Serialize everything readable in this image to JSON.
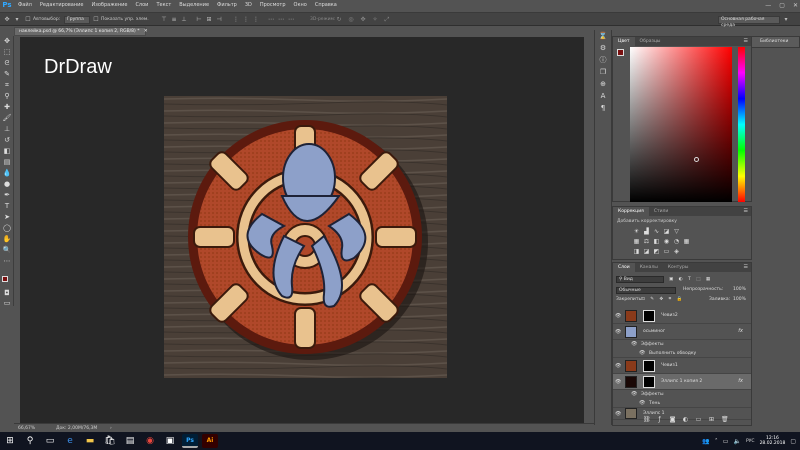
{
  "menubar": {
    "logo": "Ps",
    "items": [
      "Файл",
      "Редактирование",
      "Изображение",
      "Слои",
      "Текст",
      "Выделение",
      "Фильтр",
      "3D",
      "Просмотр",
      "Окно",
      "Справка"
    ]
  },
  "options": {
    "autoselect": "Автовыбор:",
    "group_value": "Группа",
    "show_controls": "Показать упр. элем.",
    "mode_3d": "3D-режим:",
    "workspace": "Основная рабочая среда"
  },
  "document": {
    "tab_title": "наклейка.psd @ 66,7% (Эллипс 1 копия 2, RGB/8) *",
    "watermark": "DrDraw",
    "zoom": "66,67%",
    "doc_info": "Док: 2,00М/76,3М"
  },
  "library": {
    "label": "Библиотеки"
  },
  "color_panel": {
    "tabs": [
      "Цвет",
      "Образцы"
    ],
    "fg_color": "#7a1010",
    "bg_color": "#ffffff"
  },
  "adjustments": {
    "tabs": [
      "Коррекция",
      "Стили"
    ],
    "title": "Добавить корректировку"
  },
  "layers": {
    "tabs": [
      "Слои",
      "Каналы",
      "Контуры"
    ],
    "kind_label": "Вид",
    "blend_mode": "Обычные",
    "opacity_label": "Непрозрачность:",
    "opacity_value": "100%",
    "lock_label": "Закрепить:",
    "fill_label": "Заливка:",
    "fill_value": "100%",
    "rows": [
      {
        "name": "Чевиз2",
        "type": "layer-mask",
        "fx": ""
      },
      {
        "name": "осьминог",
        "type": "layer",
        "fx": "fx"
      },
      {
        "name": "Эффекты",
        "type": "effect",
        "fx": ""
      },
      {
        "name": "Выполнить обводку",
        "type": "effect",
        "fx": ""
      },
      {
        "name": "Чевиз1",
        "type": "layer-mask",
        "fx": ""
      },
      {
        "name": "Эллипс 1 копия 2",
        "type": "layer-mask",
        "fx": "fx"
      },
      {
        "name": "Эффекты",
        "type": "effect",
        "fx": ""
      },
      {
        "name": "Тень",
        "type": "effect",
        "fx": ""
      },
      {
        "name": "Эллипс 1",
        "type": "layer",
        "fx": ""
      }
    ]
  },
  "taskbar": {
    "time": "12:16",
    "date": "28.02.2018",
    "lang": "РУС",
    "apps": [
      "Ps",
      "Ai"
    ]
  }
}
